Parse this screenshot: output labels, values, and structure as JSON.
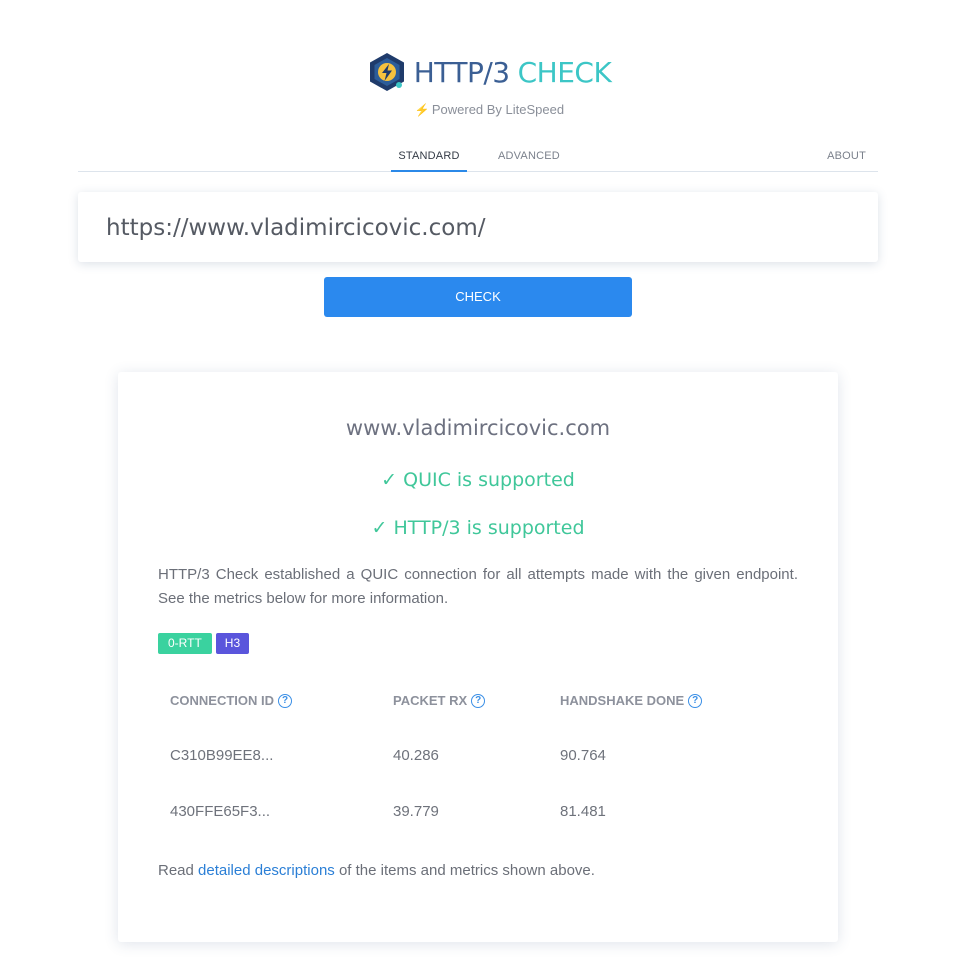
{
  "header": {
    "logo_icon": "litespeed-bolt-hexagon-icon",
    "title_part1": "HTTP/3",
    "title_part2": "CHECK",
    "powered_by": "Powered By LiteSpeed",
    "bolt_icon": "bolt-icon"
  },
  "tabs": [
    {
      "label": "STANDARD",
      "active": true
    },
    {
      "label": "ADVANCED",
      "active": false
    },
    {
      "label": "ABOUT",
      "active": false
    }
  ],
  "url_input": {
    "value": "https://www.vladimircicovic.com/"
  },
  "check_button": {
    "label": "CHECK"
  },
  "result": {
    "domain": "www.vladimircicovic.com",
    "quic_status": "✓ QUIC is supported",
    "http3_status": "✓ HTTP/3 is supported",
    "description": "HTTP/3 Check established a QUIC connection for all attempts made with the given endpoint. See the metrics below for more information.",
    "badges": [
      "0-RTT",
      "H3"
    ],
    "table": {
      "headers": [
        "CONNECTION ID",
        "PACKET RX",
        "HANDSHAKE DONE"
      ],
      "rows": [
        [
          "C310B99EE8...",
          "40.286",
          "90.764"
        ],
        [
          "430FFE65F3...",
          "39.779",
          "81.481"
        ]
      ]
    },
    "footer_prefix": "Read ",
    "footer_link": "detailed descriptions",
    "footer_suffix": " of the items and metrics shown above."
  },
  "colors": {
    "accent_blue": "#2b89ee",
    "success_green": "#40c79a",
    "badge_rtt": "#3ad29f",
    "badge_h3": "#5a55dc",
    "logo_dark": "#3b5f94",
    "logo_teal": "#3cc6c6"
  }
}
